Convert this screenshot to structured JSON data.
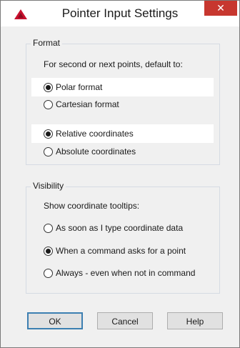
{
  "window": {
    "title": "Pointer Input Settings",
    "close_glyph": "✕",
    "app_icon": "autocad-logo-icon",
    "close_color": "#c7372f"
  },
  "format": {
    "legend": "Format",
    "prompt": "For second or next points, default to:",
    "options": [
      {
        "label": "Polar format",
        "checked": true
      },
      {
        "label": "Cartesian format",
        "checked": false
      },
      {
        "label": "Relative coordinates",
        "checked": true
      },
      {
        "label": "Absolute coordinates",
        "checked": false
      }
    ]
  },
  "visibility": {
    "legend": "Visibility",
    "prompt": "Show coordinate tooltips:",
    "options": [
      {
        "label": "As soon as I type coordinate data",
        "checked": false
      },
      {
        "label": "When a command asks for a point",
        "checked": true
      },
      {
        "label": "Always - even when not in command",
        "checked": false
      }
    ]
  },
  "buttons": {
    "ok": "OK",
    "cancel": "Cancel",
    "help": "Help"
  }
}
